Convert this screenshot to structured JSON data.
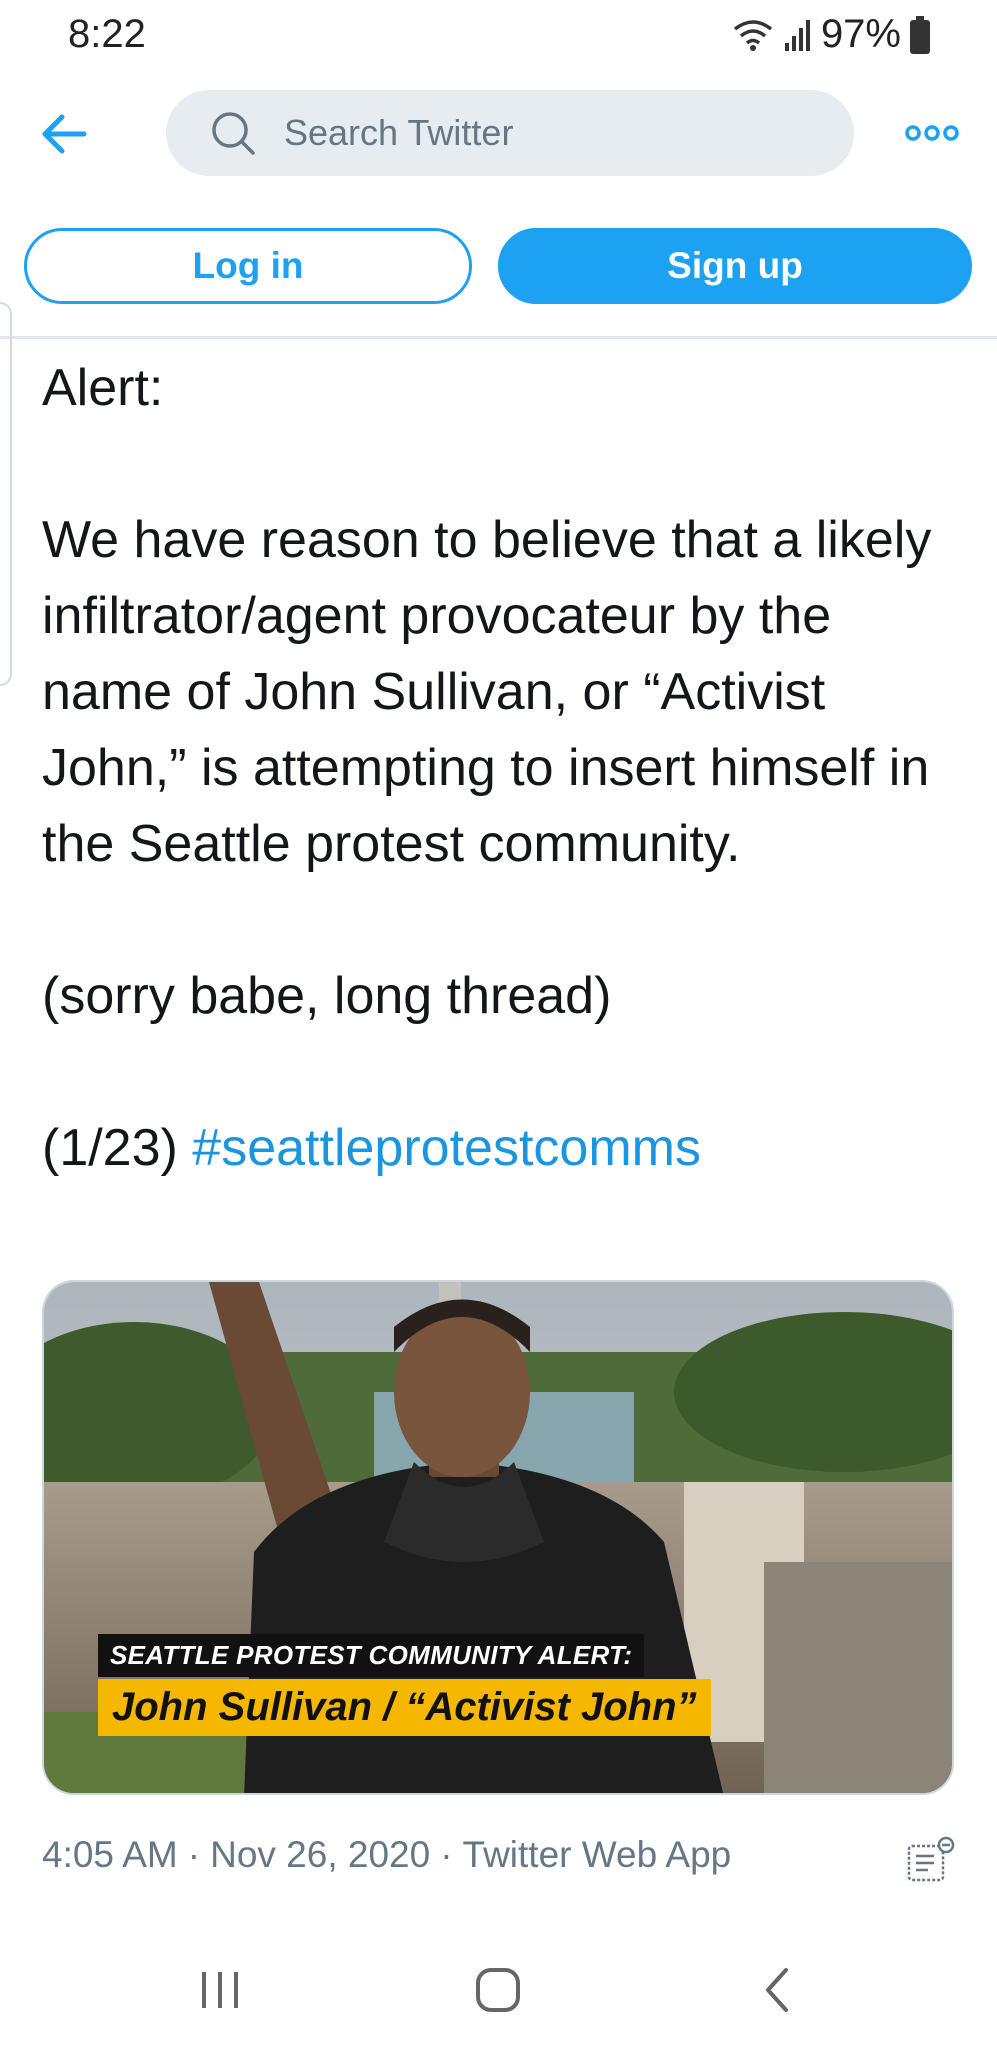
{
  "status_bar": {
    "time": "8:22",
    "battery": "97%",
    "icons": [
      "wifi-icon",
      "signal-icon",
      "battery-icon"
    ]
  },
  "nav": {
    "back_icon": "back-arrow-icon",
    "search_placeholder": "Search Twitter",
    "more_icon": "more-options-icon"
  },
  "auth": {
    "login_label": "Log in",
    "signup_label": "Sign up"
  },
  "tweet": {
    "line_alert": "Alert:",
    "paragraph": "We have reason to believe that a likely infiltrator/agent provocateur by the name of John Sullivan, or “Activist John,” is attempting to insert himself in the Seattle protest community.",
    "aside": "(sorry babe, long thread)",
    "counter": "(1/23)",
    "hashtag": "#seattleprotestcomms",
    "media": {
      "caption_top": "SEATTLE PROTEST COMMUNITY ALERT:",
      "caption_main": "John Sullivan / “Activist John”"
    },
    "time": "4:05 AM",
    "date": "Nov 26, 2020",
    "source": "Twitter Web App",
    "separator": "·"
  },
  "colors": {
    "accent": "#1da1f2",
    "hashtag": "#1b95e0",
    "muted": "#657786",
    "caption_yellow": "#f5b700"
  },
  "system_nav": [
    "recent-apps-icon",
    "home-icon",
    "back-icon"
  ]
}
